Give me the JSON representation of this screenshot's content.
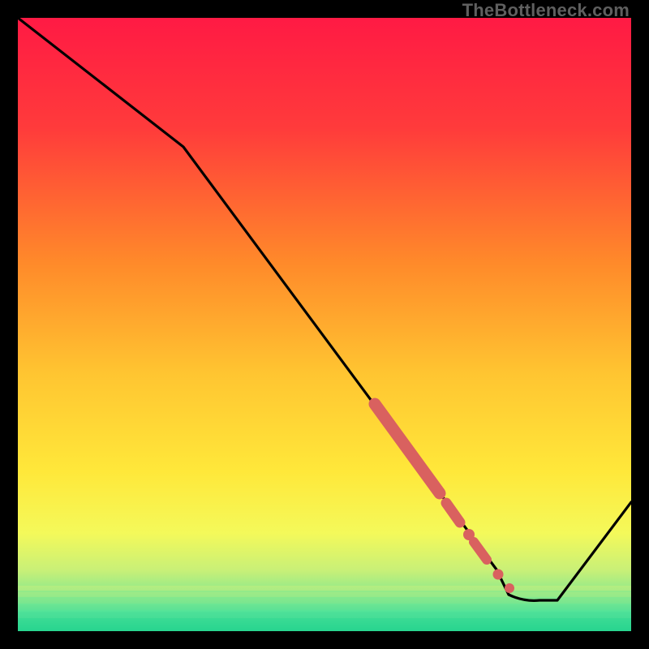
{
  "watermark": "TheBottleneck.com",
  "colors": {
    "top": "#ff1a44",
    "mid": "#ffd531",
    "green": "#27e293",
    "line": "#000000",
    "dot": "#d9615f",
    "black": "#000000"
  },
  "chart_data": {
    "type": "line",
    "title": "",
    "xlabel": "",
    "ylabel": "",
    "xlim": [
      0,
      100
    ],
    "ylim": [
      0,
      100
    ],
    "series": [
      {
        "name": "bottleneck-curve",
        "x": [
          0,
          27,
          78,
          80,
          85,
          88,
          100
        ],
        "y": [
          100,
          79,
          10,
          6,
          5,
          5,
          21
        ]
      }
    ],
    "highlight_segment": {
      "name": "highlighted-range",
      "points": [
        {
          "x": 59,
          "y": 36
        },
        {
          "x": 68,
          "y": 23
        },
        {
          "x": 70,
          "y": 20
        },
        {
          "x": 73,
          "y": 16
        },
        {
          "x": 75,
          "y": 13.5
        },
        {
          "x": 77,
          "y": 11
        }
      ]
    }
  }
}
